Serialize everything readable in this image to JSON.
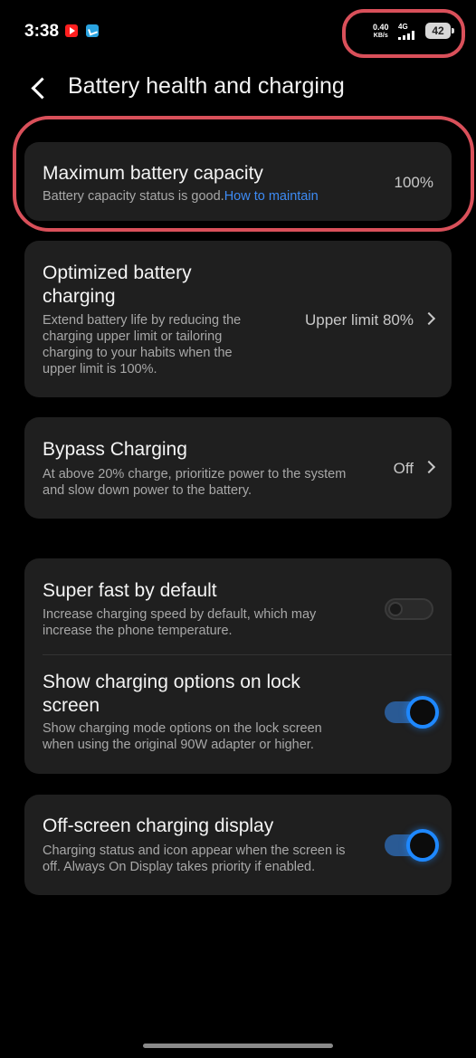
{
  "status_bar": {
    "time": "3:38",
    "net_speed": "0.40",
    "net_unit": "KB/s",
    "net_type": "4G",
    "battery_level": "42"
  },
  "header": {
    "title": "Battery health and charging"
  },
  "max_capacity": {
    "title": "Maximum battery capacity",
    "description": "Battery capacity status is good.",
    "link": "How to maintain",
    "value": "100%"
  },
  "optimized_charging": {
    "title_line1": "Optimized battery",
    "title_line2": "charging",
    "desc_line1": "Extend battery life by reducing the",
    "desc_line2": "charging upper limit or tailoring",
    "desc_line3": "charging to your habits when the",
    "desc_line4": "upper limit is 100%.",
    "value": "Upper limit 80%"
  },
  "bypass_charging": {
    "title": "Bypass Charging",
    "desc_line1": "At above 20% charge, prioritize power to the system",
    "desc_line2": "and slow down power to the battery.",
    "value": "Off"
  },
  "super_fast": {
    "title": "Super fast by default",
    "desc_line1": "Increase charging speed by default, which may",
    "desc_line2": "increase the phone temperature.",
    "enabled": false
  },
  "lock_screen_options": {
    "title_line1": "Show charging options on lock",
    "title_line2": "screen",
    "desc_line1": "Show charging mode options on the lock screen",
    "desc_line2": "when using the original 90W adapter or higher.",
    "enabled": true
  },
  "off_screen_display": {
    "title": "Off-screen charging display",
    "desc_line1": "Charging status and icon appear when the screen is",
    "desc_line2": "off. Always On Display takes priority if enabled.",
    "enabled": true
  },
  "colors": {
    "background": "#000000",
    "card": "#1f1f1f",
    "accent": "#1e88ff",
    "link": "#3d8bf5",
    "annotation": "#d9505a"
  }
}
